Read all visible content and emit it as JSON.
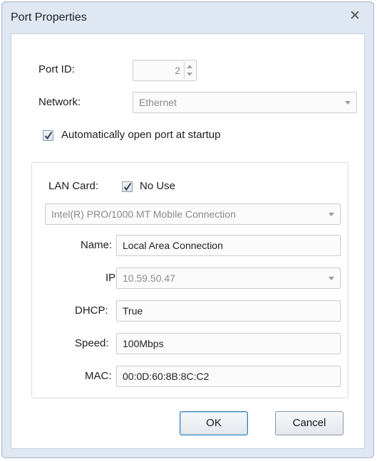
{
  "window": {
    "title": "Port Properties",
    "close_glyph": "✕"
  },
  "port": {
    "id_label": "Port ID:",
    "id_value": "2"
  },
  "network": {
    "label": "Network:",
    "value": "Ethernet"
  },
  "auto_open": {
    "label": "Automatically open port at startup",
    "checked": true
  },
  "lan": {
    "label": "LAN Card:",
    "no_use_label": "No Use",
    "no_use_checked": true,
    "card_value": "Intel(R) PRO/1000 MT Mobile Connection",
    "name_label": "Name:",
    "name_value": "Local Area Connection",
    "ip_label": "IP:",
    "ip_value": "10.59.50.47",
    "dhcp_label": "DHCP:",
    "dhcp_value": "True",
    "speed_label": "Speed:",
    "speed_value": "100Mbps",
    "mac_label": "MAC:",
    "mac_value": "00:0D:60:8B:8C:C2"
  },
  "buttons": {
    "ok": "OK",
    "cancel": "Cancel"
  },
  "colors": {
    "frame": "#dfe7f2",
    "accent": "#3c7fb1"
  }
}
